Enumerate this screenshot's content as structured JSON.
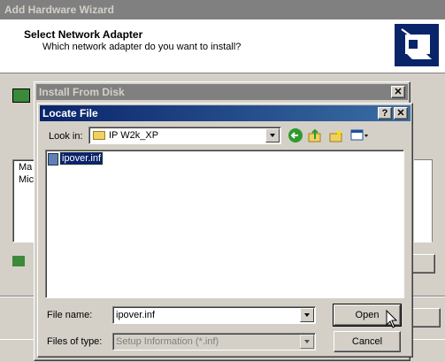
{
  "wizard": {
    "title": "Add Hardware Wizard",
    "heading": "Select Network Adapter",
    "subheading": "Which network adapter do you want to install?",
    "list_items": [
      "Ma",
      "Mic"
    ]
  },
  "install_from_disk": {
    "title": "Install From Disk",
    "close_label": "✕"
  },
  "locate_file": {
    "title": "Locate File",
    "help_label": "?",
    "close_label": "✕",
    "look_in_label": "Look in:",
    "look_in_value": "IP W2k_XP",
    "files": [
      {
        "name": "ipover.inf",
        "selected": true
      }
    ],
    "file_name_label": "File name:",
    "file_name_value": "ipover.inf",
    "files_of_type_label": "Files of type:",
    "files_of_type_value": "Setup Information (*.inf)",
    "open_label": "Open",
    "cancel_label": "Cancel"
  },
  "icons": {
    "back": "back-icon",
    "up": "up-folder-icon",
    "new_folder": "new-folder-icon",
    "views": "views-menu-icon"
  },
  "colors": {
    "active_title": "#0a246a",
    "inactive_title": "#808080",
    "selection": "#0a246a"
  }
}
